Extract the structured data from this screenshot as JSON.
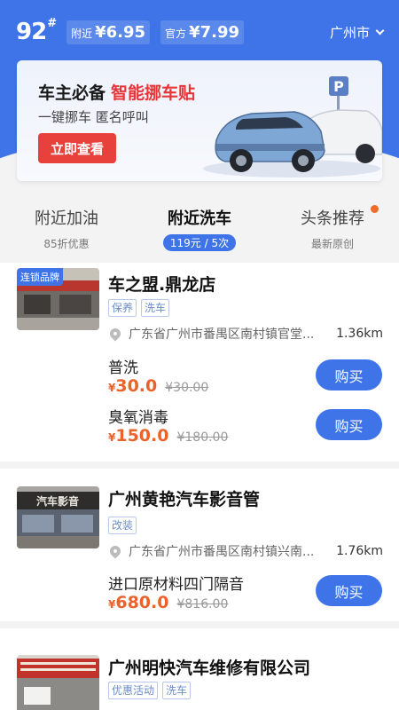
{
  "header": {
    "grade": "92",
    "grade_mark": "#",
    "nearby_label": "附近",
    "nearby_price": "¥6.95",
    "official_label": "官方",
    "official_price": "¥7.99",
    "city": "广州市"
  },
  "banner": {
    "title": "车主必备",
    "title_highlight": "智能挪车贴",
    "subtitle": "一键挪车  匿名呼叫",
    "button": "立即查看"
  },
  "tabs": [
    {
      "title": "附近加油",
      "sub": "85折优惠"
    },
    {
      "title": "附近洗车",
      "sub": "119元 / 5次"
    },
    {
      "title": "头条推荐",
      "sub": "最新原创"
    }
  ],
  "shops": [
    {
      "badge": "连锁品牌",
      "name": "车之盟.鼎龙店",
      "tags": [
        "保养",
        "洗车"
      ],
      "address": "广东省广州市番禺区南村镇官堂...",
      "distance": "1.36km",
      "services": [
        {
          "name": "普洗",
          "currency": "¥",
          "price": "30.0",
          "old_price": "¥30.00",
          "buy": "购买"
        },
        {
          "name": "臭氧消毒",
          "currency": "¥",
          "price": "150.0",
          "old_price": "¥180.00",
          "buy": "购买"
        }
      ]
    },
    {
      "name": "广州黄艳汽车影音管",
      "tags": [
        "改装"
      ],
      "address": "广东省广州市番禺区南村镇兴南...",
      "distance": "1.76km",
      "services": [
        {
          "name": "进口原材料四门隔音",
          "currency": "¥",
          "price": "680.0",
          "old_price": "¥816.00",
          "buy": "购买"
        }
      ]
    },
    {
      "name": "广州明快汽车维修有限公司",
      "tags": [
        "优惠活动",
        "洗车"
      ]
    }
  ],
  "colors": {
    "brand_blue": "#3f74e8",
    "accent_red": "#e8403a",
    "price_orange": "#e9632a"
  }
}
